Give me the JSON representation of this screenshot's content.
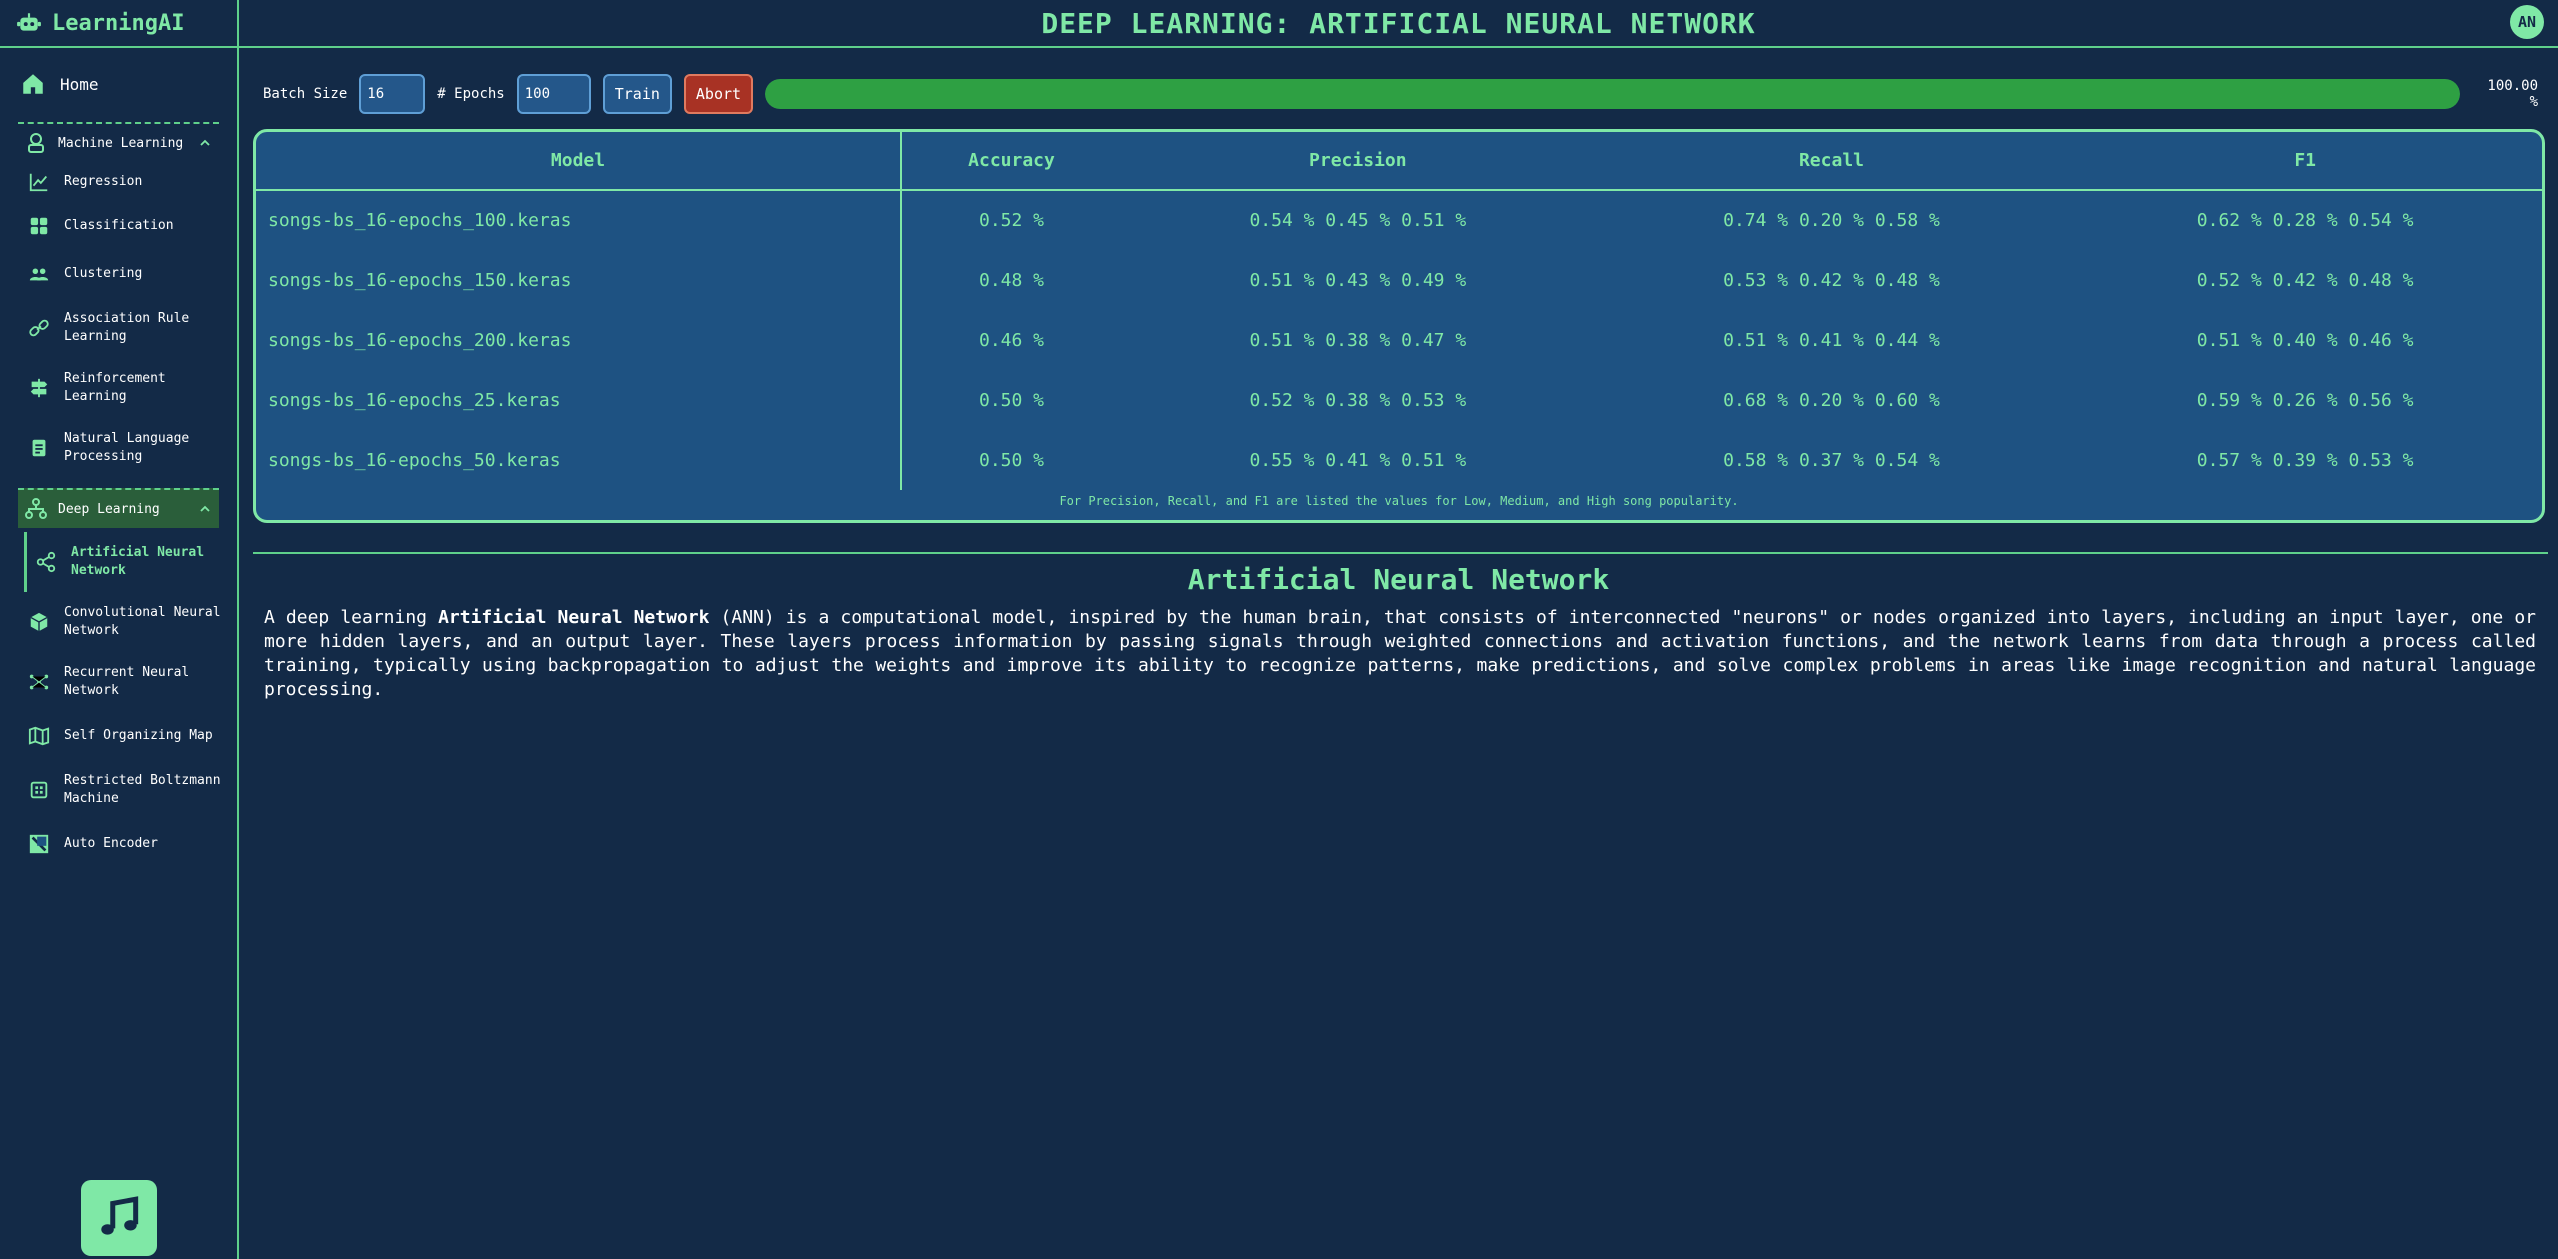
{
  "app": {
    "name": "LearningAI"
  },
  "header": {
    "title": "DEEP LEARNING: ARTIFICIAL NEURAL NETWORK",
    "avatar": "AN"
  },
  "sidebar": {
    "home": "Home",
    "machine_learning": {
      "label": "Machine Learning",
      "items": [
        {
          "label": "Regression",
          "icon": "chart-line-icon"
        },
        {
          "label": "Classification",
          "icon": "grid-icon"
        },
        {
          "label": "Clustering",
          "icon": "users-icon"
        },
        {
          "label": "Association Rule Learning",
          "icon": "link-icon"
        },
        {
          "label": "Reinforcement Learning",
          "icon": "signpost-icon"
        },
        {
          "label": "Natural Language Processing",
          "icon": "document-icon"
        }
      ]
    },
    "deep_learning": {
      "label": "Deep Learning",
      "items": [
        {
          "label": "Artificial Neural Network",
          "icon": "share-icon",
          "active": true
        },
        {
          "label": "Convolutional Neural Network",
          "icon": "box-icon"
        },
        {
          "label": "Recurrent Neural Network",
          "icon": "network-icon"
        },
        {
          "label": "Self Organizing Map",
          "icon": "map-icon"
        },
        {
          "label": "Restricted Boltzmann Machine",
          "icon": "chip-icon"
        },
        {
          "label": "Auto Encoder",
          "icon": "image-icon"
        }
      ]
    }
  },
  "toolbar": {
    "batch_size_label": "Batch Size",
    "batch_size_value": "16",
    "epochs_label": "# Epochs",
    "epochs_value": "100",
    "train_label": "Train",
    "abort_label": "Abort",
    "progress_percent": 100,
    "progress_label": "100.00 %"
  },
  "results": {
    "headers": [
      "Model",
      "Accuracy",
      "Precision",
      "Recall",
      "F1"
    ],
    "rows": [
      [
        "songs-bs_16-epochs_100.keras",
        "0.52 %",
        "0.54 % 0.45 % 0.51 %",
        "0.74 % 0.20 % 0.58 %",
        "0.62 % 0.28 % 0.54 %"
      ],
      [
        "songs-bs_16-epochs_150.keras",
        "0.48 %",
        "0.51 % 0.43 % 0.49 %",
        "0.53 % 0.42 % 0.48 %",
        "0.52 % 0.42 % 0.48 %"
      ],
      [
        "songs-bs_16-epochs_200.keras",
        "0.46 %",
        "0.51 % 0.38 % 0.47 %",
        "0.51 % 0.41 % 0.44 %",
        "0.51 % 0.40 % 0.46 %"
      ],
      [
        "songs-bs_16-epochs_25.keras",
        "0.50 %",
        "0.52 % 0.38 % 0.53 %",
        "0.68 % 0.20 % 0.60 %",
        "0.59 % 0.26 % 0.56 %"
      ],
      [
        "songs-bs_16-epochs_50.keras",
        "0.50 %",
        "0.55 % 0.41 % 0.51 %",
        "0.58 % 0.37 % 0.54 %",
        "0.57 % 0.39 % 0.53 %"
      ]
    ],
    "note": "For Precision, Recall, and F1 are listed the values for Low, Medium, and High song popularity."
  },
  "description": {
    "title": "Artificial Neural Network",
    "intro": "A deep learning ",
    "term": "Artificial Neural Network",
    "body": " (ANN) is a computational model, inspired by the human brain, that consists of interconnected \"neurons\" or nodes organized into layers, including an input layer, one or more hidden layers, and an output layer. These layers process information by passing signals through weighted connections and activation functions, and the network learns from data through a process called training, typically using backpropagation to adjust the weights and improve its ability to recognize patterns, make predictions, and solve complex problems in areas like image recognition and natural language processing."
  },
  "colors": {
    "background": "#132a47",
    "accent": "#7fe8a6",
    "panel": "#1e5282",
    "progress": "#2ea043",
    "abort": "#a83224"
  }
}
